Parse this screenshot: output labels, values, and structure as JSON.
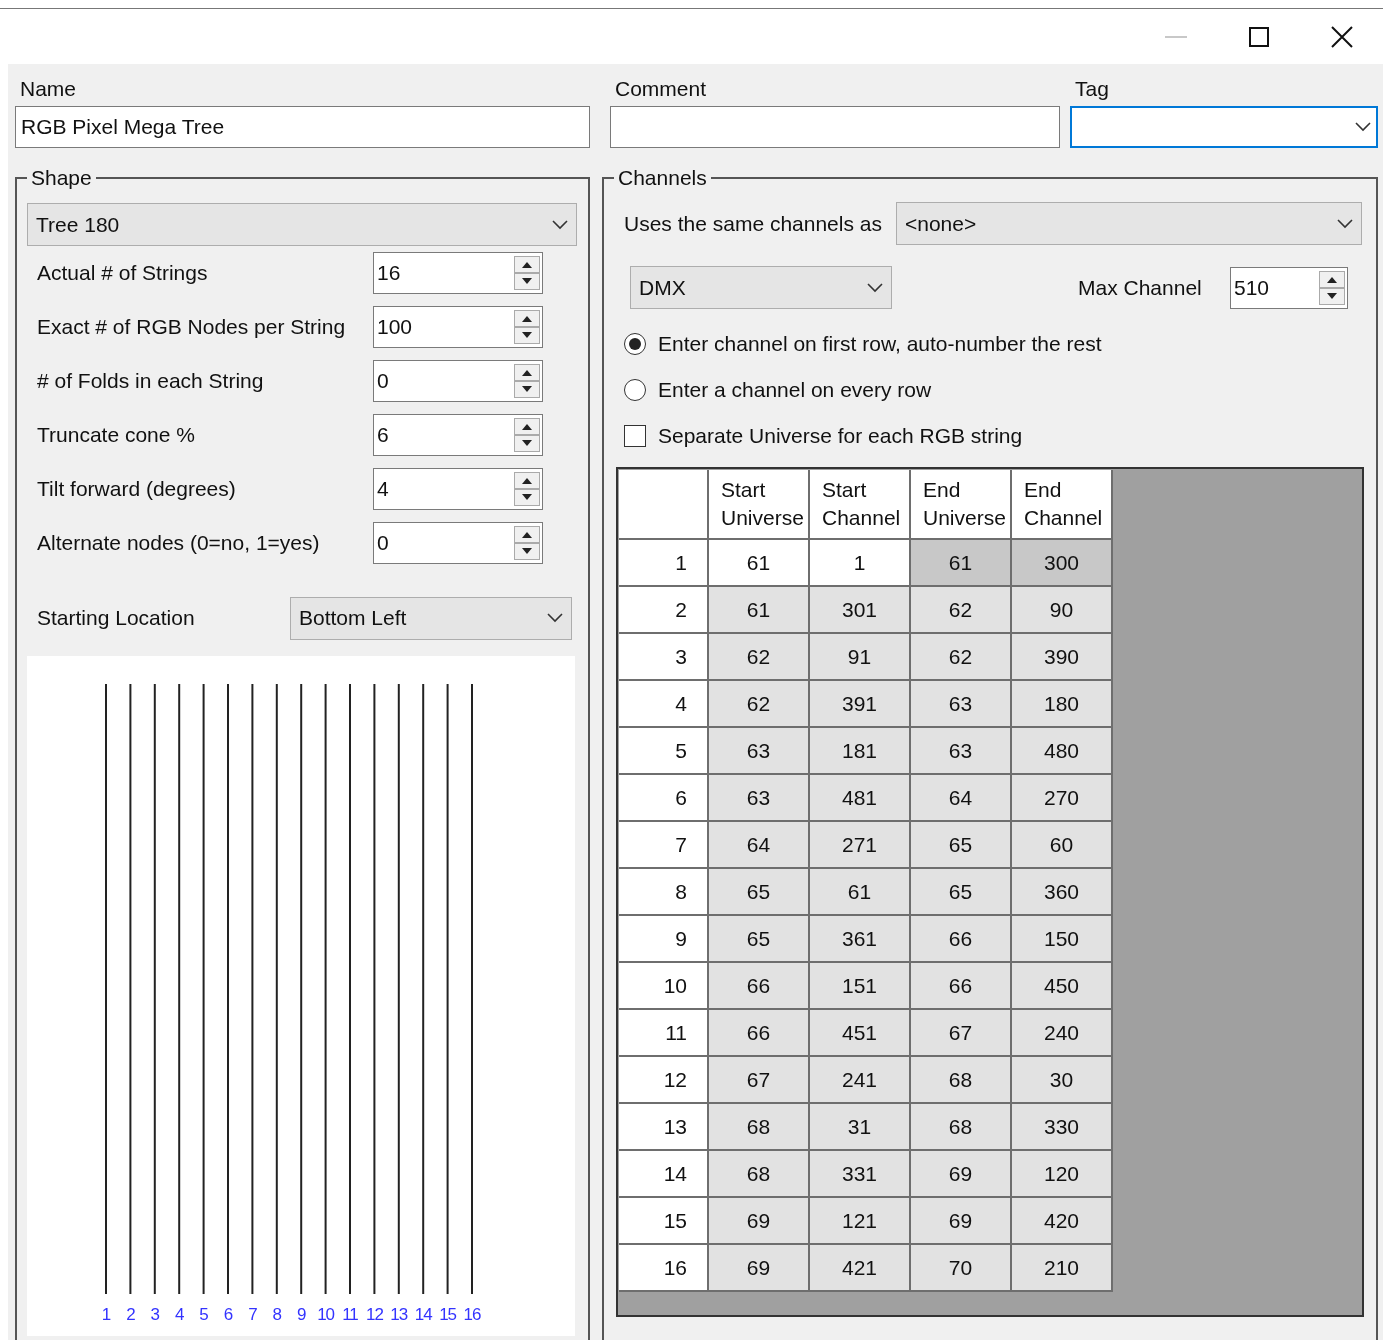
{
  "header_fields": [
    {
      "kind": "text",
      "label": "Name",
      "value": "RGB Pixel Mega Tree",
      "focused": false
    },
    {
      "kind": "text",
      "label": "Comment",
      "focused": false
    },
    {
      "kind": "dropdown",
      "label": "Tag",
      "focused": true
    }
  ],
  "shape": {
    "title": "Shape",
    "type": "Tree 180",
    "properties": [
      {
        "label": "Actual # of Strings",
        "value": "16"
      },
      {
        "label": "Exact # of RGB Nodes per String",
        "value": "100"
      },
      {
        "label": "# of Folds in each String",
        "value": "0"
      },
      {
        "label": "Truncate cone %",
        "value": "6"
      },
      {
        "label": "Tilt forward (degrees)",
        "value": "4"
      },
      {
        "label": "Alternate nodes (0=no, 1=yes)",
        "value": "0"
      }
    ],
    "starting_location": {
      "label": "Starting Location",
      "value": "Bottom Left"
    },
    "string_labels": [
      "1",
      "2",
      "3",
      "4",
      "5",
      "6",
      "7",
      "8",
      "9",
      "10",
      "11",
      "12",
      "13",
      "14",
      "15",
      "16"
    ]
  },
  "channels": {
    "title": "Channels",
    "same_as": {
      "label": "Uses the same channels as",
      "value": "<none>"
    },
    "protocol": "DMX",
    "max_channel": {
      "label": "Max Channel",
      "value": "510"
    },
    "options": [
      {
        "kind": "radio",
        "label": "Enter channel on first row, auto-number the rest",
        "selected": true
      },
      {
        "kind": "radio",
        "label": "Enter a channel on every row",
        "selected": false
      },
      {
        "kind": "checkbox",
        "label": "Separate Universe for each RGB string",
        "checked": false
      }
    ],
    "grid": {
      "columns": [
        "Start Universe",
        "Start Channel",
        "End Universe",
        "End Channel"
      ],
      "rows": [
        {
          "label": "1",
          "cells": [
            "61",
            "1",
            "61",
            "300"
          ],
          "editable": true,
          "selected": true
        },
        {
          "label": "2",
          "cells": [
            "61",
            "301",
            "62",
            "90"
          ],
          "editable": false,
          "selected": false
        },
        {
          "label": "3",
          "cells": [
            "62",
            "91",
            "62",
            "390"
          ],
          "editable": false,
          "selected": false
        },
        {
          "label": "4",
          "cells": [
            "62",
            "391",
            "63",
            "180"
          ],
          "editable": false,
          "selected": false
        },
        {
          "label": "5",
          "cells": [
            "63",
            "181",
            "63",
            "480"
          ],
          "editable": false,
          "selected": false
        },
        {
          "label": "6",
          "cells": [
            "63",
            "481",
            "64",
            "270"
          ],
          "editable": false,
          "selected": false
        },
        {
          "label": "7",
          "cells": [
            "64",
            "271",
            "65",
            "60"
          ],
          "editable": false,
          "selected": false
        },
        {
          "label": "8",
          "cells": [
            "65",
            "61",
            "65",
            "360"
          ],
          "editable": false,
          "selected": false
        },
        {
          "label": "9",
          "cells": [
            "65",
            "361",
            "66",
            "150"
          ],
          "editable": false,
          "selected": false
        },
        {
          "label": "10",
          "cells": [
            "66",
            "151",
            "66",
            "450"
          ],
          "editable": false,
          "selected": false
        },
        {
          "label": "11",
          "cells": [
            "66",
            "451",
            "67",
            "240"
          ],
          "editable": false,
          "selected": false
        },
        {
          "label": "12",
          "cells": [
            "67",
            "241",
            "68",
            "30"
          ],
          "editable": false,
          "selected": false
        },
        {
          "label": "13",
          "cells": [
            "68",
            "31",
            "68",
            "330"
          ],
          "editable": false,
          "selected": false
        },
        {
          "label": "14",
          "cells": [
            "68",
            "331",
            "69",
            "120"
          ],
          "editable": false,
          "selected": false
        },
        {
          "label": "15",
          "cells": [
            "69",
            "121",
            "69",
            "420"
          ],
          "editable": false,
          "selected": false
        },
        {
          "label": "16",
          "cells": [
            "69",
            "421",
            "70",
            "210"
          ],
          "editable": false,
          "selected": false
        }
      ]
    }
  }
}
